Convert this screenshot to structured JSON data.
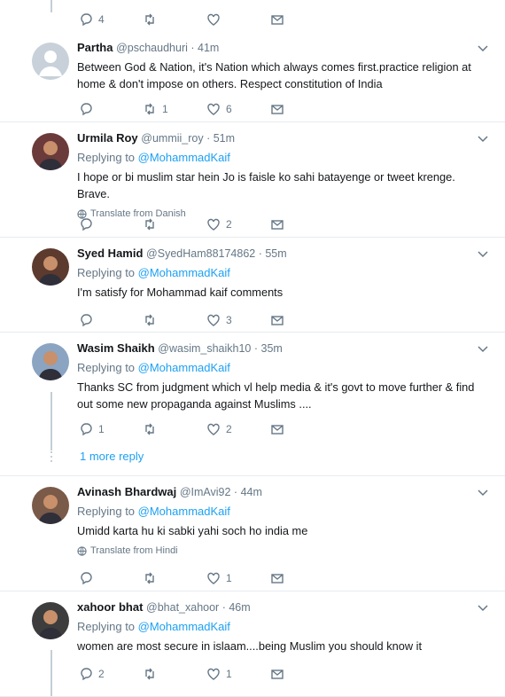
{
  "top_actions": {
    "replies": "4",
    "retweets": "",
    "likes": ""
  },
  "tweets": [
    {
      "name": "Partha",
      "handle": "@pschaudhuri · 41m",
      "replying_prefix": "",
      "replying_to": "",
      "text": "Between God & Nation, it's Nation which always comes first.practice religion at home & don't impose on others. Respect constitution of India",
      "translate": "",
      "replies": "",
      "retweets": "1",
      "likes": "6"
    },
    {
      "name": "Urmila Roy",
      "handle": "@ummii_roy · 51m",
      "replying_prefix": "Replying to ",
      "replying_to": "@MohammadKaif",
      "text": "I hope or bi muslim star hein Jo is faisle ko sahi batayenge or tweet krenge. Brave.",
      "translate": "Translate from Danish",
      "replies": "",
      "retweets": "",
      "likes": "2"
    },
    {
      "name": "Syed Hamid",
      "handle": "@SyedHam88174862 · 55m",
      "replying_prefix": "Replying to ",
      "replying_to": "@MohammadKaif",
      "text": "I'm satisfy for Mohammad kaif comments",
      "translate": "",
      "replies": "",
      "retweets": "",
      "likes": "3"
    },
    {
      "name": "Wasim Shaikh",
      "handle": "@wasim_shaikh10 · 35m",
      "replying_prefix": "Replying to ",
      "replying_to": "@MohammadKaif",
      "text": "Thanks SC from judgment which vl help media & it's govt to move  further  & find out some new propaganda against Muslims    ....",
      "translate": "",
      "replies": "1",
      "retweets": "",
      "likes": "2"
    },
    {
      "name": "Avinash Bhardwaj",
      "handle": "@ImAvi92 · 44m",
      "replying_prefix": "Replying to ",
      "replying_to": "@MohammadKaif",
      "text": "Umidd karta hu ki sabki yahi soch ho india me",
      "translate": "Translate from Hindi",
      "replies": "",
      "retweets": "",
      "likes": "1"
    },
    {
      "name": "xahoor bhat",
      "handle": "@bhat_xahoor · 46m",
      "replying_prefix": "Replying to ",
      "replying_to": "@MohammadKaif",
      "text": "women are most secure in islaam....being Muslim you should know it",
      "translate": "",
      "replies": "2",
      "retweets": "",
      "likes": "1"
    }
  ],
  "more_replies": "1 more reply",
  "colors": {
    "accent": "#1da1f2",
    "muted": "#657786",
    "border": "#e6ecf0"
  }
}
